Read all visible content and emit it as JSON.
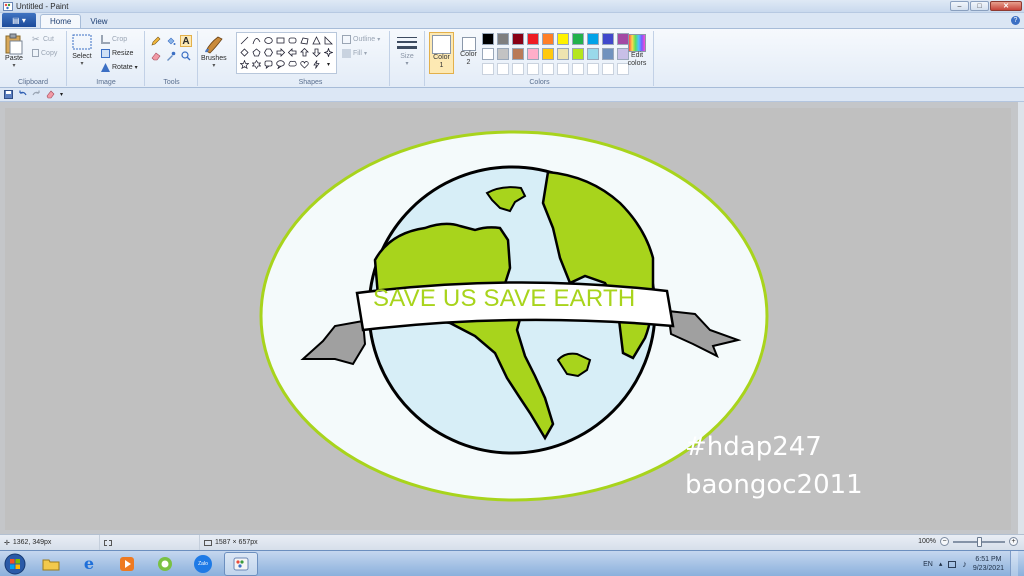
{
  "window": {
    "title": "Untitled - Paint",
    "controls": [
      "–",
      "□",
      "✕"
    ]
  },
  "tabs": {
    "file": "▤ ▾",
    "home": "Home",
    "view": "View"
  },
  "clipboard": {
    "paste": "Paste",
    "cut": "Cut",
    "copy": "Copy",
    "label": "Clipboard"
  },
  "image": {
    "select": "Select",
    "crop": "Crop",
    "resize": "Resize",
    "rotate": "Rotate",
    "label": "Image"
  },
  "tools": {
    "label": "Tools"
  },
  "brushes": {
    "label": "Brushes"
  },
  "shapes": {
    "outline": "Outline",
    "fill": "Fill",
    "label": "Shapes"
  },
  "size": {
    "label": "Size"
  },
  "colors": {
    "color1": "Color 1",
    "color2": "Color 2",
    "edit": "Edit colors",
    "label": "Colors",
    "palette": [
      "#000000",
      "#7f7f7f",
      "#880015",
      "#ed1c24",
      "#ff7f27",
      "#fff200",
      "#22b14c",
      "#00a2e8",
      "#3f48cc",
      "#a349a4",
      "#ffffff",
      "#c3c3c3",
      "#b97a57",
      "#ffaec9",
      "#ffc90e",
      "#efe4b0",
      "#b5e61d",
      "#99d9ea",
      "#7092be",
      "#c8bfe7",
      "#ffffff",
      "#ffffff",
      "#ffffff",
      "#ffffff",
      "#ffffff",
      "#ffffff",
      "#ffffff",
      "#ffffff",
      "#ffffff",
      "#ffffff"
    ]
  },
  "drawing": {
    "banner_text": "SAVE US SAVE EARTH",
    "watermark_line1": "#hdap247",
    "watermark_line2": "baongoc2011",
    "land_color": "#a8d41c",
    "ocean_color": "#d7eef7",
    "ring_color": "#a8d41c",
    "ribbon_color": "#a0a0a0"
  },
  "status": {
    "cursor_pos": "1362, 349px",
    "canvas_size": "1587 × 657px",
    "zoom": "100%"
  },
  "taskbar": {
    "lang": "EN",
    "time": "6:51 PM",
    "date": "9/23/2021",
    "zalo": "Zalo"
  }
}
